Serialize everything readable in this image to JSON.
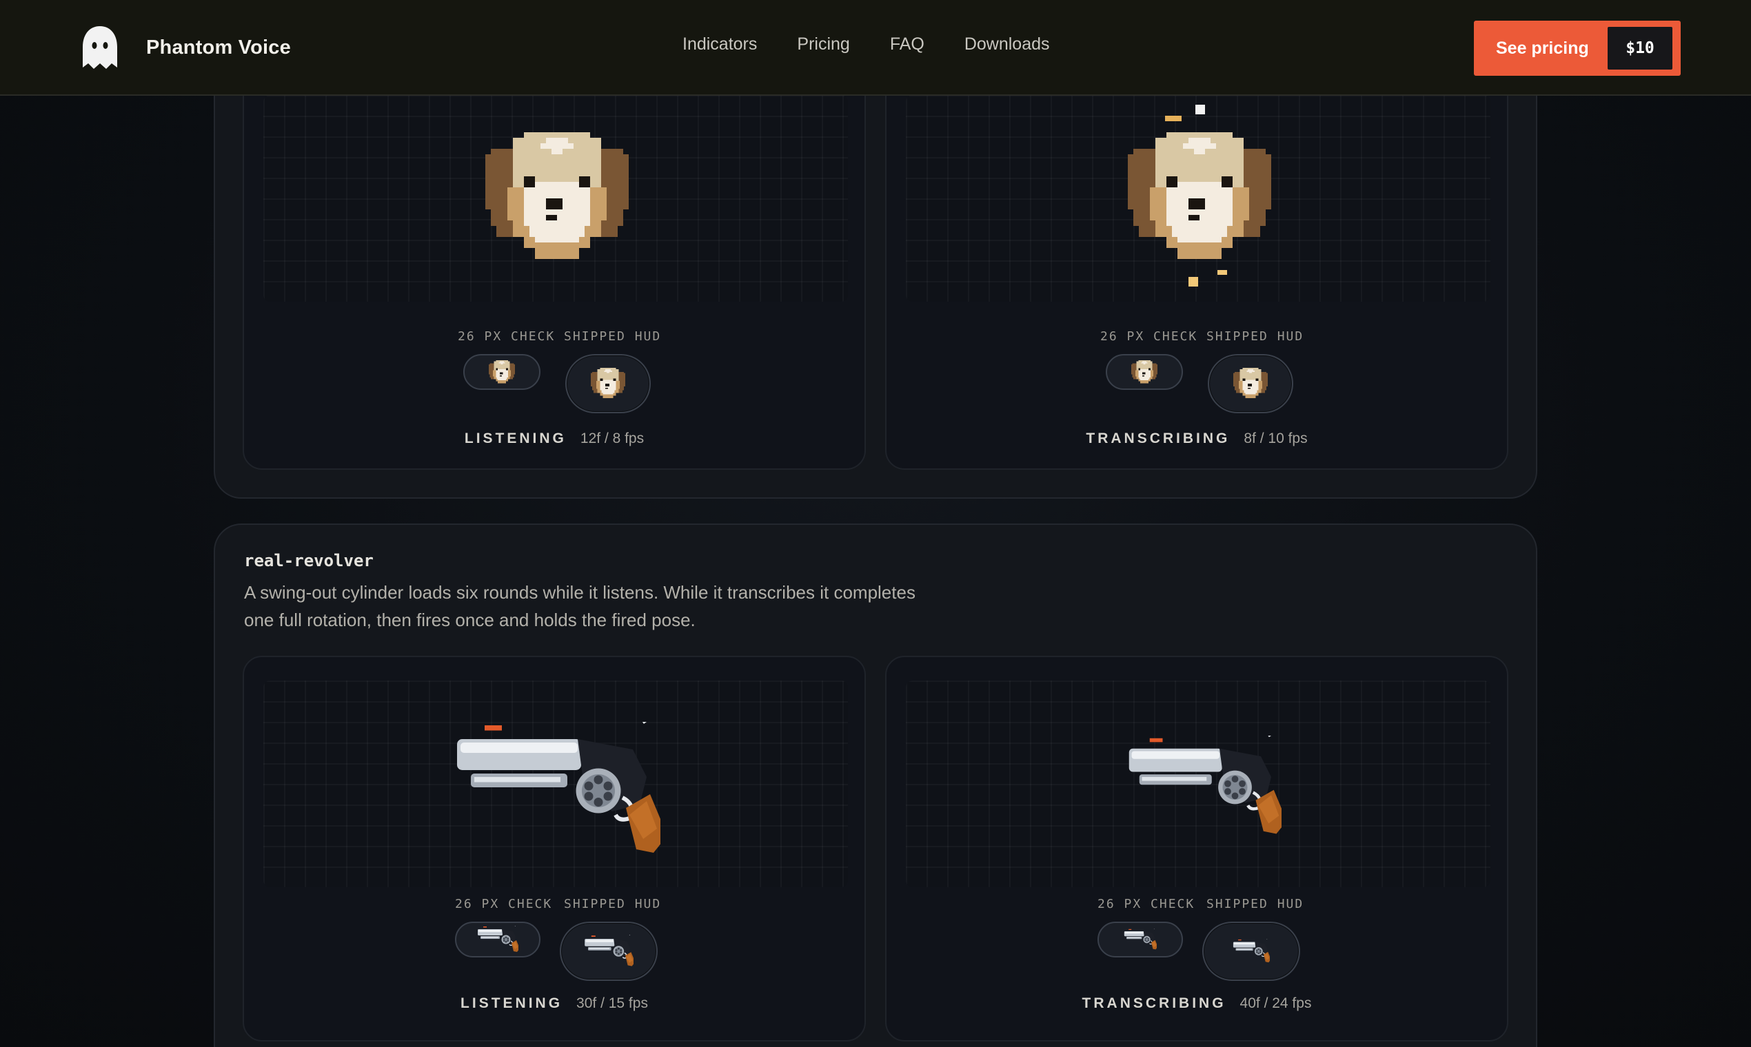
{
  "header": {
    "logo_icon": "ghost-icon",
    "brand": "Phantom Voice",
    "nav": [
      {
        "label": "Indicators"
      },
      {
        "label": "Pricing"
      },
      {
        "label": "FAQ"
      },
      {
        "label": "Downloads"
      }
    ],
    "cta_label": "See pricing",
    "cta_price": "$10"
  },
  "sections": [
    {
      "icon": "dog-icon",
      "cards": [
        {
          "check_label": "26 PX CHECK",
          "hud_label": "SHIPPED HUD",
          "state": "LISTENING",
          "fps": "12f / 8 fps"
        },
        {
          "check_label": "26 PX CHECK",
          "hud_label": "SHIPPED HUD",
          "state": "TRANSCRIBING",
          "fps": "8f / 10 fps"
        }
      ]
    },
    {
      "title": "real-revolver",
      "description": "A swing-out cylinder loads six rounds while it listens. While it transcribes it completes one full rotation, then fires once and holds the fired pose.",
      "icon": "revolver-icon",
      "cards": [
        {
          "check_label": "26 PX CHECK",
          "hud_label": "SHIPPED HUD",
          "state": "LISTENING",
          "fps": "30f / 15 fps"
        },
        {
          "check_label": "26 PX CHECK",
          "hud_label": "SHIPPED HUD",
          "state": "TRANSCRIBING",
          "fps": "40f / 24 fps"
        }
      ]
    }
  ],
  "colors": {
    "accent": "#ec5a38",
    "background": "#0b0e12",
    "header": "#15160f",
    "dog_brown": "#7a5634",
    "dog_tan": "#c9a06a",
    "dog_cream": "#efe5cf",
    "revolver_steel": "#b8bfc8",
    "revolver_grip": "#b0611f"
  }
}
